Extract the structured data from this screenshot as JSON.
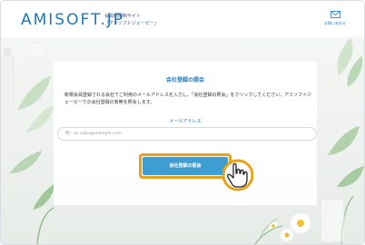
{
  "header": {
    "logo": "AMISOFT.JP",
    "tagline_line1": "会員制限制サイト",
    "tagline_line2": "「アミソフトジェーピー」",
    "contact_label": "お問い合わせ"
  },
  "card": {
    "title": "会社登録の照会",
    "description": "新規会員登録される会社でご利用のメールアドレスを入力し、「会社登録の照会」をクリックしてください。アミソフトジェーピーでの会社登録の有無を照会します。",
    "email_label": "メールアドレス",
    "email_placeholder": "例：ac-cube@example.com",
    "submit_label": "会社登録の照会"
  },
  "colors": {
    "brand_blue": "#1f77b8",
    "button_blue": "#3f9ed1",
    "highlight_orange": "#e8a21a"
  },
  "icons": {
    "contact": "mail-icon",
    "pointer": "hand-pointer-icon"
  }
}
